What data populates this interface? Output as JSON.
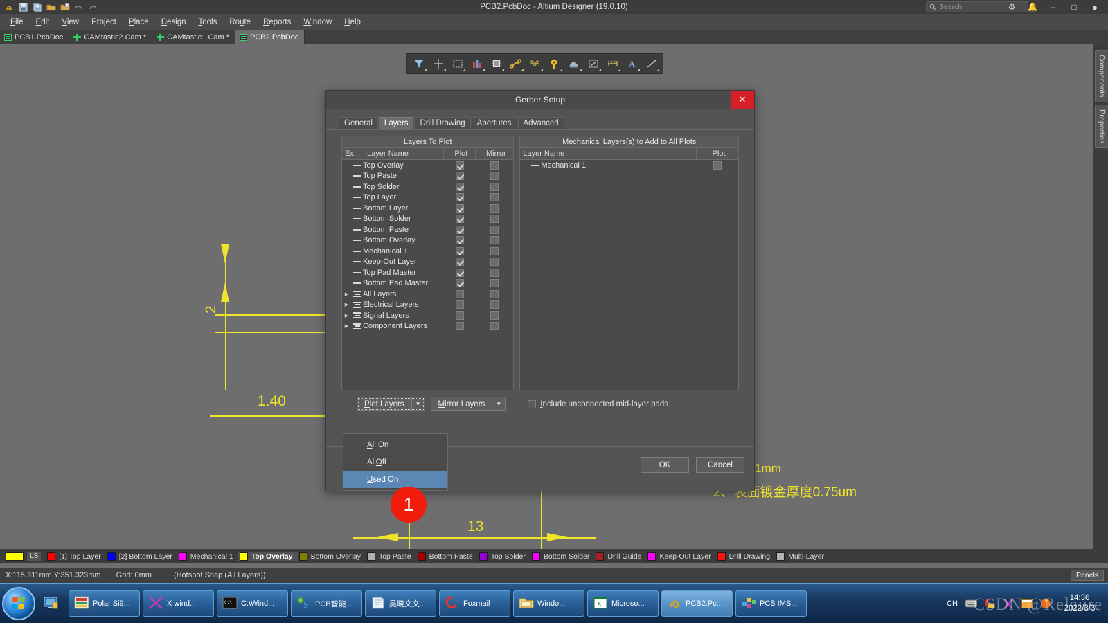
{
  "titlebar": {
    "title": "PCB2.PcbDoc - Altium Designer (19.0.10)",
    "search_placeholder": "Search",
    "search_icon": "search-icon",
    "quick_icons": [
      "altium-logo-icon",
      "save-icon",
      "save-all-icon",
      "open-icon",
      "open-project-icon",
      "undo-icon",
      "redo-icon"
    ],
    "sys": {
      "settings": "gear-icon",
      "notifications": "bell-icon",
      "minimize": "minimize-icon",
      "maximize": "maximize-icon",
      "account": "account-icon"
    }
  },
  "menubar": {
    "items": [
      {
        "label": "File",
        "accel": "F"
      },
      {
        "label": "Edit",
        "accel": "E"
      },
      {
        "label": "View",
        "accel": "V"
      },
      {
        "label": "Project",
        "accel": "j"
      },
      {
        "label": "Place",
        "accel": "P"
      },
      {
        "label": "Design",
        "accel": "D"
      },
      {
        "label": "Tools",
        "accel": "T"
      },
      {
        "label": "Route",
        "accel": "u"
      },
      {
        "label": "Reports",
        "accel": "R"
      },
      {
        "label": "Window",
        "accel": "W"
      },
      {
        "label": "Help",
        "accel": "H"
      }
    ]
  },
  "doctabs": [
    {
      "label": "PCB1.PcbDoc",
      "icon": "pcb-doc-icon",
      "type": "pcb",
      "active": false
    },
    {
      "label": "CAMtastic2.Cam *",
      "icon": "cam-doc-icon",
      "type": "cam",
      "active": false
    },
    {
      "label": "CAMtastic1.Cam *",
      "icon": "cam-doc-icon",
      "type": "cam",
      "active": false
    },
    {
      "label": "PCB2.PcbDoc",
      "icon": "pcb-doc-icon",
      "type": "pcb",
      "active": true
    }
  ],
  "toolbar": {
    "buttons": [
      {
        "name": "filter-icon"
      },
      {
        "name": "crosshair-icon"
      },
      {
        "name": "select-area-icon"
      },
      {
        "name": "layer-stack-icon"
      },
      {
        "name": "component-icon"
      },
      {
        "name": "route-icon"
      },
      {
        "name": "differential-pair-icon"
      },
      {
        "name": "via-icon"
      },
      {
        "name": "polygon-pour-icon"
      },
      {
        "name": "line-box-icon"
      },
      {
        "name": "dimension-icon"
      },
      {
        "name": "text-icon"
      },
      {
        "name": "line-icon"
      }
    ]
  },
  "right_panel": {
    "tabs": [
      "Components",
      "Properties"
    ]
  },
  "canvas": {
    "dimension_labels": [
      {
        "text": "2",
        "rotated": true
      },
      {
        "text": "1.40"
      },
      {
        "text": "13"
      }
    ],
    "annotations": [
      {
        "text": "1mm"
      },
      {
        "text": "2、表面镀金厚度0.75um"
      }
    ]
  },
  "dialog": {
    "title": "Gerber Setup",
    "close_icon": "close-icon",
    "tabs": [
      {
        "label": "General",
        "active": false
      },
      {
        "label": "Layers",
        "active": true
      },
      {
        "label": "Drill Drawing",
        "active": false
      },
      {
        "label": "Apertures",
        "active": false
      },
      {
        "label": "Advanced",
        "active": false
      }
    ],
    "left_pane": {
      "header": "Layers To Plot",
      "columns": [
        "Ex...",
        "Layer Name",
        "Plot",
        "Mirror"
      ],
      "rows": [
        {
          "name": "Top Overlay",
          "kind": "layer",
          "plot": true,
          "mirror": false
        },
        {
          "name": "Top Paste",
          "kind": "layer",
          "plot": true,
          "mirror": false
        },
        {
          "name": "Top Solder",
          "kind": "layer",
          "plot": true,
          "mirror": false
        },
        {
          "name": "Top Layer",
          "kind": "layer",
          "plot": true,
          "mirror": false
        },
        {
          "name": "Bottom Layer",
          "kind": "layer",
          "plot": true,
          "mirror": false
        },
        {
          "name": "Bottom Solder",
          "kind": "layer",
          "plot": true,
          "mirror": false
        },
        {
          "name": "Bottom Paste",
          "kind": "layer",
          "plot": true,
          "mirror": false
        },
        {
          "name": "Bottom Overlay",
          "kind": "layer",
          "plot": true,
          "mirror": false
        },
        {
          "name": "Mechanical 1",
          "kind": "layer",
          "plot": true,
          "mirror": false
        },
        {
          "name": "Keep-Out Layer",
          "kind": "layer",
          "plot": true,
          "mirror": false
        },
        {
          "name": "Top Pad Master",
          "kind": "layer",
          "plot": true,
          "mirror": false
        },
        {
          "name": "Bottom Pad Master",
          "kind": "layer",
          "plot": true,
          "mirror": false
        },
        {
          "name": "All Layers",
          "kind": "group",
          "plot": false,
          "mirror": false
        },
        {
          "name": "Electrical Layers",
          "kind": "group",
          "plot": false,
          "mirror": false
        },
        {
          "name": "Signal Layers",
          "kind": "group",
          "plot": false,
          "mirror": false
        },
        {
          "name": "Component Layers",
          "kind": "group",
          "plot": false,
          "mirror": false
        }
      ]
    },
    "right_pane": {
      "header": "Mechanical Layers(s) to Add to All Plots",
      "columns": [
        "Layer Name",
        "Plot"
      ],
      "rows": [
        {
          "name": "Mechanical 1",
          "kind": "layer",
          "plot": false
        }
      ]
    },
    "controls": {
      "plot_layers": {
        "label": "Plot Layers",
        "accel": "P"
      },
      "mirror_layers": {
        "label": "Mirror Layers",
        "accel": "M"
      },
      "include_unconnected": {
        "label": "Include unconnected mid-layer pads",
        "accel": "I",
        "checked": false
      }
    },
    "dropdown": {
      "open": true,
      "items": [
        {
          "label": "All On",
          "accel": "A",
          "selected": false
        },
        {
          "label": "All Off",
          "accel": "O",
          "selected": false
        },
        {
          "label": "Used On",
          "accel": "U",
          "selected": true
        }
      ]
    },
    "footer": {
      "ok": "OK",
      "cancel": "Cancel"
    }
  },
  "badge": {
    "number": "1"
  },
  "legend": {
    "ls_label": "LS",
    "ls_color": "#ffff00",
    "items": [
      {
        "label": "[1] Top Layer",
        "color": "#ff0000",
        "active": false
      },
      {
        "label": "[2] Bottom Layer",
        "color": "#0000ff",
        "active": false
      },
      {
        "label": "Mechanical 1",
        "color": "#ff00ff",
        "active": false
      },
      {
        "label": "Top Overlay",
        "color": "#ffff00",
        "active": true
      },
      {
        "label": "Bottom Overlay",
        "color": "#808000",
        "active": false
      },
      {
        "label": "Top Paste",
        "color": "#b0b0b0",
        "active": false
      },
      {
        "label": "Bottom Paste",
        "color": "#a00000",
        "active": false
      },
      {
        "label": "Top Solder",
        "color": "#9400d3",
        "active": false
      },
      {
        "label": "Bottom Solder",
        "color": "#ff00ff",
        "active": false
      },
      {
        "label": "Drill Guide",
        "color": "#a52020",
        "active": false
      },
      {
        "label": "Keep-Out Layer",
        "color": "#ff00ff",
        "active": false
      },
      {
        "label": "Drill Drawing",
        "color": "#ff1010",
        "active": false
      },
      {
        "label": "Multi-Layer",
        "color": "#b4b4b4",
        "active": false
      }
    ]
  },
  "statusbar": {
    "coords": "X:115.311mm Y:351.323mm",
    "grid": "Grid: 0mm",
    "snap": "(Hotspot Snap (All Layers))",
    "panels_button": "Panels"
  },
  "taskbar": {
    "start_icon": "windows-start-icon",
    "quick_launch": [
      {
        "name": "show-desktop-icon"
      }
    ],
    "tasks": [
      {
        "label": "Polar Si9...",
        "icon": "polar-si9000-icon",
        "active": false
      },
      {
        "label": "X wind...",
        "icon": "x-window-icon",
        "active": false
      },
      {
        "label": "C:\\Wind...",
        "icon": "command-prompt-icon",
        "active": false
      },
      {
        "label": "PCB智能...",
        "icon": "pcb-tool-icon",
        "active": false
      },
      {
        "label": "吴晓文文...",
        "icon": "notepad-icon",
        "active": false
      },
      {
        "label": "Foxmail",
        "icon": "foxmail-icon",
        "active": false
      },
      {
        "label": "Windo...",
        "icon": "explorer-icon",
        "active": false
      },
      {
        "label": "Microso...",
        "icon": "excel-icon",
        "active": false
      },
      {
        "label": "PCB2.Pc...",
        "icon": "altium-icon",
        "active": true
      },
      {
        "label": "PCB IMS...",
        "icon": "pcb-ims-icon",
        "active": false
      }
    ],
    "tray": {
      "icons": [
        "input-method-ch-icon",
        "keyboard-icon",
        "foxmail-tray-icon",
        "x-tray-icon",
        "window-tray-icon",
        "firefox-tray-icon"
      ],
      "ime_label": "CH",
      "time": "14:36",
      "date": "2022/3/3"
    }
  },
  "watermark": {
    "text": "CSDN @Relaure"
  }
}
